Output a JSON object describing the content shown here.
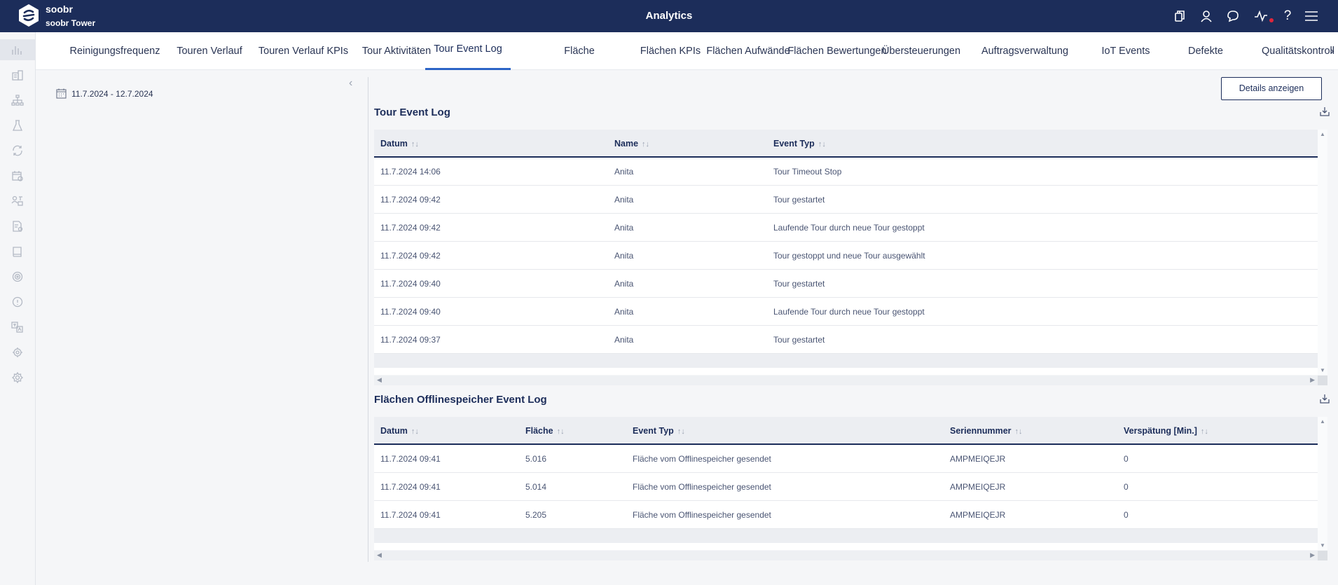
{
  "header": {
    "brand": "soobr",
    "brand_sub": "soobr Tower",
    "title": "Analytics",
    "icons": [
      "copy-icon",
      "user-icon",
      "chat-icon",
      "activity-icon",
      "help-icon",
      "menu-icon"
    ],
    "accent": "#1c2d5a",
    "alert_color": "#e0263b"
  },
  "sidebar": {
    "icons": [
      "bar-chart-icon",
      "building-icon",
      "hierarchy-icon",
      "flask-icon",
      "refresh-icon",
      "calendar-settings-icon",
      "people-icon",
      "document-settings-icon",
      "book-icon",
      "target-icon",
      "info-icon",
      "translate-icon",
      "gear-grid-icon",
      "settings-icon"
    ]
  },
  "tabs": [
    "Reinigungsfrequenz",
    "Touren Verlauf",
    "Touren Verlauf KPIs",
    "Tour Aktivitäten",
    "Tour Event Log",
    "Fläche",
    "Flächen KPIs",
    "Flächen Aufwände",
    "Flächen Bewertungen",
    "Übersteuerungen",
    "Auftragsverwaltung",
    "IoT Events",
    "Defekte",
    "Qualitätskontroll"
  ],
  "active_tab": "Tour Event Log",
  "filter": {
    "date_range": "11.7.2024 - 12.7.2024"
  },
  "details_button": "Details anzeigen",
  "tour_log": {
    "title": "Tour Event Log",
    "columns": [
      "Datum",
      "Name",
      "Event Typ"
    ],
    "rows": [
      [
        "11.7.2024 14:06",
        "Anita",
        "Tour Timeout Stop"
      ],
      [
        "11.7.2024 09:42",
        "Anita",
        "Tour gestartet"
      ],
      [
        "11.7.2024 09:42",
        "Anita",
        "Laufende Tour durch neue Tour gestoppt"
      ],
      [
        "11.7.2024 09:42",
        "Anita",
        "Tour gestoppt und neue Tour ausgewählt"
      ],
      [
        "11.7.2024 09:40",
        "Anita",
        "Tour gestartet"
      ],
      [
        "11.7.2024 09:40",
        "Anita",
        "Laufende Tour durch neue Tour gestoppt"
      ],
      [
        "11.7.2024 09:37",
        "Anita",
        "Tour gestartet"
      ]
    ]
  },
  "offline_log": {
    "title": "Flächen Offlinespeicher Event Log",
    "columns": [
      "Datum",
      "Fläche",
      "Event Typ",
      "Seriennummer",
      "Verspätung [Min.]"
    ],
    "rows": [
      [
        "11.7.2024 09:41",
        "5.016",
        "Fläche vom Offlinespeicher gesendet",
        "AMPMEIQEJR",
        "0"
      ],
      [
        "11.7.2024 09:41",
        "5.014",
        "Fläche vom Offlinespeicher gesendet",
        "AMPMEIQEJR",
        "0"
      ],
      [
        "11.7.2024 09:41",
        "5.205",
        "Fläche vom Offlinespeicher gesendet",
        "AMPMEIQEJR",
        "0"
      ]
    ]
  }
}
